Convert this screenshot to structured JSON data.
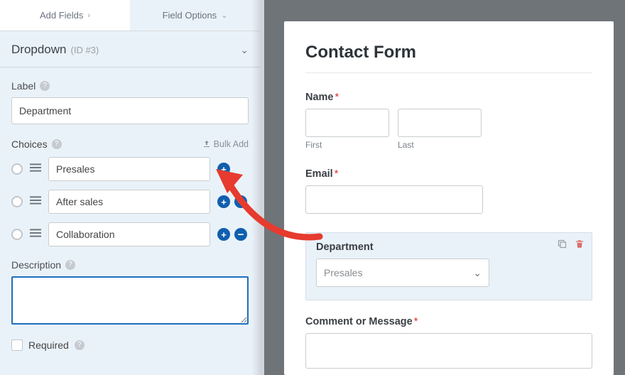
{
  "tabs": {
    "add_fields": "Add Fields",
    "field_options": "Field Options"
  },
  "section": {
    "type": "Dropdown",
    "id_tag": "(ID #3)"
  },
  "labels": {
    "label": "Label",
    "choices": "Choices",
    "bulk_add": "Bulk Add",
    "description": "Description",
    "required": "Required"
  },
  "label_value": "Department",
  "choices": [
    {
      "value": "Presales",
      "removable": false
    },
    {
      "value": "After sales",
      "removable": true
    },
    {
      "value": "Collaboration",
      "removable": true
    }
  ],
  "description_value": "",
  "preview": {
    "title": "Contact Form",
    "name": {
      "label": "Name",
      "first_sub": "First",
      "last_sub": "Last"
    },
    "email_label": "Email",
    "department": {
      "label": "Department",
      "selected": "Presales"
    },
    "comment_label": "Comment or Message"
  }
}
